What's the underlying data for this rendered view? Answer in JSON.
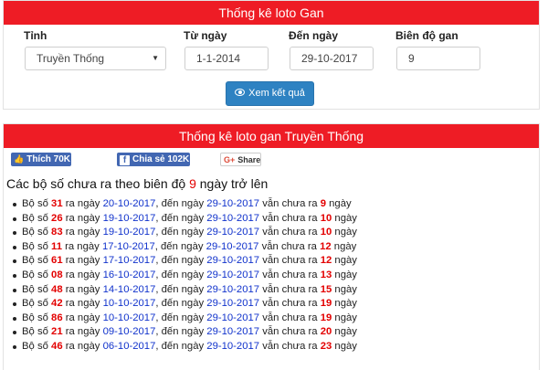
{
  "form_panel": {
    "title": "Thống kê loto Gan",
    "province_label": "Tỉnh",
    "province_value": "Truyền Thống",
    "from_label": "Từ ngày",
    "from_value": "1-1-2014",
    "to_label": "Đến ngày",
    "to_value": "29-10-2017",
    "range_label": "Biên độ gan",
    "range_value": "9",
    "submit_label": "Xem kết quả",
    "submit_icon": "eye-icon"
  },
  "result_panel": {
    "title": "Thống kê loto gan Truyền Thống",
    "like_label": "Thích 70K",
    "share_label": "Chia sẻ 102K",
    "gplus_mark": "G+",
    "gplus_label": "Share",
    "subtitle_prefix": "Các bộ số chưa ra theo biên độ",
    "subtitle_value": "9",
    "subtitle_suffix": "ngày trở lên",
    "rows": [
      {
        "num": "31",
        "date": "20-10-2017",
        "end": "29-10-2017",
        "days": "9"
      },
      {
        "num": "26",
        "date": "19-10-2017",
        "end": "29-10-2017",
        "days": "10"
      },
      {
        "num": "83",
        "date": "19-10-2017",
        "end": "29-10-2017",
        "days": "10"
      },
      {
        "num": "11",
        "date": "17-10-2017",
        "end": "29-10-2017",
        "days": "12"
      },
      {
        "num": "61",
        "date": "17-10-2017",
        "end": "29-10-2017",
        "days": "12"
      },
      {
        "num": "08",
        "date": "16-10-2017",
        "end": "29-10-2017",
        "days": "13"
      },
      {
        "num": "48",
        "date": "14-10-2017",
        "end": "29-10-2017",
        "days": "15"
      },
      {
        "num": "42",
        "date": "10-10-2017",
        "end": "29-10-2017",
        "days": "19"
      },
      {
        "num": "86",
        "date": "10-10-2017",
        "end": "29-10-2017",
        "days": "19"
      },
      {
        "num": "21",
        "date": "09-10-2017",
        "end": "29-10-2017",
        "days": "20"
      },
      {
        "num": "46",
        "date": "06-10-2017",
        "end": "29-10-2017",
        "days": "23"
      }
    ],
    "row_text": {
      "t1": "Bộ số",
      "t2": "ra ngày",
      "t3": ", đến ngày",
      "t4": "vẫn chưa ra",
      "t5": "ngày"
    }
  },
  "colors": {
    "header_red": "#ee1c25",
    "button_blue": "#2e82c2",
    "facebook_blue": "#4267b2",
    "number_red": "#e30000",
    "date_blue": "#1133cc"
  }
}
